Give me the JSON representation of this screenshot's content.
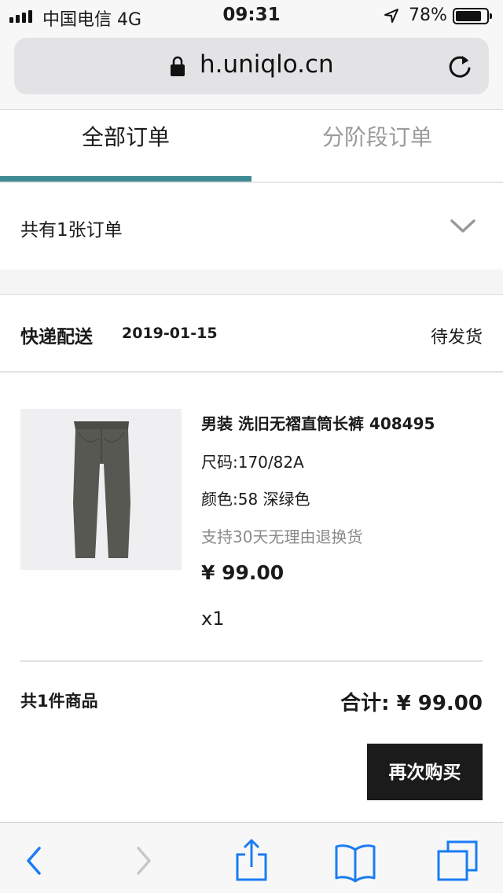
{
  "status_bar": {
    "carrier": "中国电信   4G",
    "time": "09:31",
    "battery": "78%"
  },
  "browser": {
    "url": "h.uniqlo.cn"
  },
  "tabs": [
    {
      "label": "全部订单"
    },
    {
      "label": "分阶段订单"
    }
  ],
  "order_summary": {
    "count_text": "共有1张订单"
  },
  "order": {
    "delivery_type": "快递配送",
    "date": "2019-01-15",
    "status": "待发货",
    "product": {
      "name": "男装 洗旧无褶直筒长裤 408495",
      "size": "尺码:170/82A",
      "color": "颜色:58 深绿色",
      "return_policy": "支持30天无理由退换货",
      "price": "¥ 99.00",
      "quantity": "x1"
    },
    "total_count": "共1件商品",
    "total": "合计: ¥ 99.00",
    "buy_again_label": "再次购买"
  },
  "colors": {
    "accent": "#3f8a92",
    "safari_blue": "#1a7cf3",
    "dark": "#1b1b1b",
    "muted": "#8a8a8a"
  },
  "icons": [
    "signal-icon",
    "location-icon",
    "battery-icon",
    "lock-icon",
    "reload-icon",
    "chevron-down-icon",
    "back-icon",
    "forward-icon",
    "share-icon",
    "bookmarks-icon",
    "tabs-icon"
  ]
}
